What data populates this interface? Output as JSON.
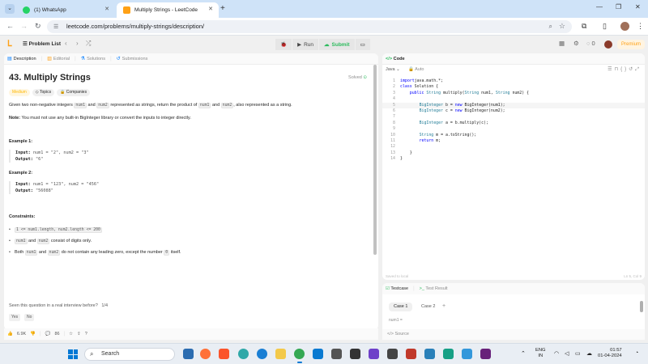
{
  "browser": {
    "tabs": [
      {
        "label": "(1) WhatsApp",
        "icon": "whatsapp-icon",
        "active": false
      },
      {
        "label": "Multiply Strings - LeetCode",
        "icon": "leetcode-icon",
        "active": true
      }
    ],
    "url": "leetcode.com/problems/multiply-strings/description/"
  },
  "header": {
    "problem_list_label": "Problem List",
    "run_label": "Run",
    "submit_label": "Submit",
    "streak_count": "0",
    "premium_label": "Premium"
  },
  "left_tabs": [
    {
      "label": "Description",
      "icon": "description-icon"
    },
    {
      "label": "Editorial",
      "icon": "editorial-icon"
    },
    {
      "label": "Solutions",
      "icon": "solutions-icon"
    },
    {
      "label": "Submissions",
      "icon": "submissions-icon"
    }
  ],
  "problem": {
    "title": "43. Multiply Strings",
    "solved_label": "Solved",
    "difficulty": "Medium",
    "topics_label": "Topics",
    "companies_label": "Companies",
    "desc_1": "Given two non-negative integers",
    "desc_num1": "num1",
    "desc_2": "and",
    "desc_num2": "num2",
    "desc_3": "represented as strings, return the product of",
    "desc_4": ", also represented as a string.",
    "note_label": "Note:",
    "note_text": "You must not use any built-in BigInteger library or convert the inputs to integer directly.",
    "examples": [
      {
        "title": "Example 1:",
        "input_label": "Input:",
        "input": "num1 = \"2\", num2 = \"3\"",
        "output_label": "Output:",
        "output": "\"6\""
      },
      {
        "title": "Example 2:",
        "input_label": "Input:",
        "input": "num1 = \"123\", num2 = \"456\"",
        "output_label": "Output:",
        "output": "\"56088\""
      }
    ],
    "constraints_title": "Constraints:",
    "constraint_1_code": "1 <= num1.length, num2.length <= 200",
    "constraint_2_text": "consist of digits only.",
    "constraint_3_a": "Both",
    "constraint_3_b": "do not contain any leading zero, except the number",
    "constraint_3_zero": "0",
    "constraint_3_c": "itself.",
    "interview_q": "Seen this question in a real interview before?",
    "interview_page": "1/4",
    "yes_label": "Yes",
    "no_label": "No"
  },
  "footer": {
    "likes": "6.9K",
    "comments": "86"
  },
  "editor": {
    "title": "Code",
    "language": "Java",
    "auto_label": "Auto",
    "lines": [
      {
        "n": "1",
        "segs": [
          [
            "kw",
            "import"
          ],
          [
            "",
            "java.math.*;"
          ]
        ]
      },
      {
        "n": "2",
        "segs": [
          [
            "kw",
            "class"
          ],
          [
            "",
            " Solution {"
          ]
        ]
      },
      {
        "n": "3",
        "segs": [
          [
            "",
            "    "
          ],
          [
            "kw",
            "public"
          ],
          [
            "",
            " "
          ],
          [
            "tp",
            "String"
          ],
          [
            "",
            " multiply("
          ],
          [
            "tp",
            "String"
          ],
          [
            "",
            " num1, "
          ],
          [
            "tp",
            "String"
          ],
          [
            "",
            " num2) {"
          ]
        ]
      },
      {
        "n": "4",
        "segs": [
          [
            "",
            ""
          ]
        ]
      },
      {
        "n": "5",
        "segs": [
          [
            "",
            "        "
          ],
          [
            "tp",
            "BigInteger"
          ],
          [
            "",
            " b = "
          ],
          [
            "kw",
            "new"
          ],
          [
            "",
            " BigInteger(num1);"
          ]
        ]
      },
      {
        "n": "6",
        "segs": [
          [
            "",
            "        "
          ],
          [
            "tp",
            "BigInteger"
          ],
          [
            "",
            " c = "
          ],
          [
            "kw",
            "new"
          ],
          [
            "",
            " BigInteger(num2);"
          ]
        ]
      },
      {
        "n": "7",
        "segs": [
          [
            "",
            ""
          ]
        ]
      },
      {
        "n": "8",
        "segs": [
          [
            "",
            "        "
          ],
          [
            "tp",
            "BigInteger"
          ],
          [
            "",
            " a = b.multiply(c);"
          ]
        ]
      },
      {
        "n": "9",
        "segs": [
          [
            "",
            ""
          ]
        ]
      },
      {
        "n": "10",
        "segs": [
          [
            "",
            "        "
          ],
          [
            "tp",
            "String"
          ],
          [
            "",
            " m = a.toString();"
          ]
        ]
      },
      {
        "n": "11",
        "segs": [
          [
            "",
            "        "
          ],
          [
            "kw",
            "return"
          ],
          [
            "",
            " m;"
          ]
        ]
      },
      {
        "n": "12",
        "segs": [
          [
            "",
            ""
          ]
        ]
      },
      {
        "n": "13",
        "segs": [
          [
            "",
            "    }"
          ]
        ]
      },
      {
        "n": "14",
        "segs": [
          [
            "",
            "}"
          ]
        ]
      }
    ],
    "status_left": "Saved to local",
    "status_right": "Ln 5, Col 9"
  },
  "testpanel": {
    "testcase_label": "Testcase",
    "result_label": "Test Result",
    "cases": [
      "Case 1",
      "Case 2"
    ],
    "field_label": "num1 ="
  },
  "source_label": "Source",
  "taskbar": {
    "search_label": "Search",
    "lang_line1": "ENG",
    "lang_line2": "IN",
    "time": "01:57",
    "date": "01-04-2024"
  },
  "colors": {
    "leetcode_orange": "#ffa116",
    "success_green": "#2cbb5d",
    "windows_blue": "#0078d4"
  }
}
